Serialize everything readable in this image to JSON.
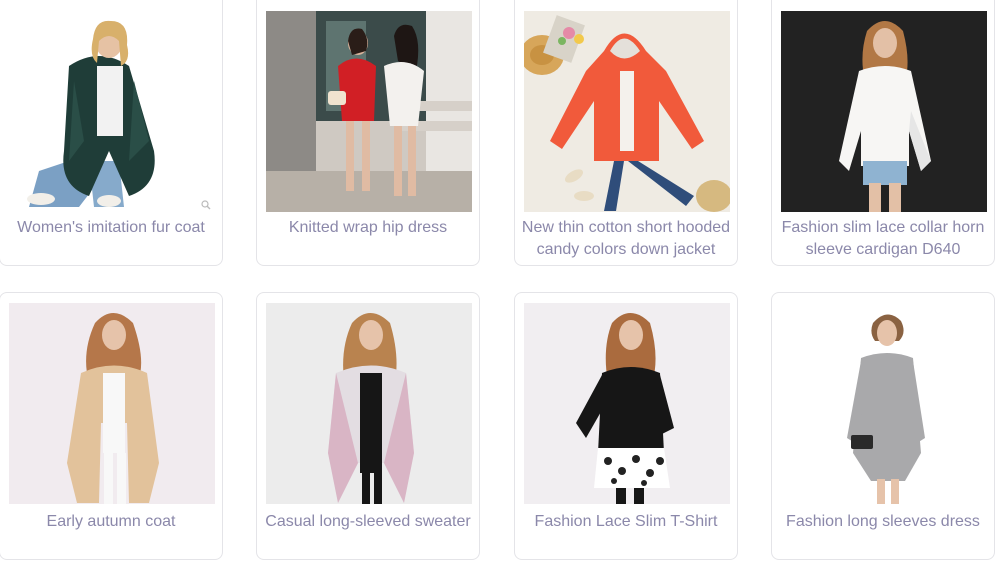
{
  "products": [
    {
      "title": "Women's imitation fur coat",
      "image_alt": "Woman in dark green faux fur coat"
    },
    {
      "title": "Knitted wrap hip dress",
      "image_alt": "Two women in red and white dresses"
    },
    {
      "title": "New thin cotton short hooded candy colors down jacket",
      "image_alt": "Orange hooded puffer jacket flat lay"
    },
    {
      "title": "Fashion slim lace collar horn sleeve cardigan D640",
      "image_alt": "Woman in white lace cardigan"
    },
    {
      "title": "Early autumn coat",
      "image_alt": "Woman in beige autumn coat"
    },
    {
      "title": "Casual long-sleeved sweater",
      "image_alt": "Woman in plaid long cardigan"
    },
    {
      "title": "Fashion Lace Slim T-Shirt",
      "image_alt": "Woman in black lace t-shirt"
    },
    {
      "title": "Fashion long sleeves dress",
      "image_alt": "Woman in grey long sleeve dress"
    }
  ],
  "colors": {
    "caption": "#8b88aa",
    "card_border": "#e4e4e8"
  }
}
